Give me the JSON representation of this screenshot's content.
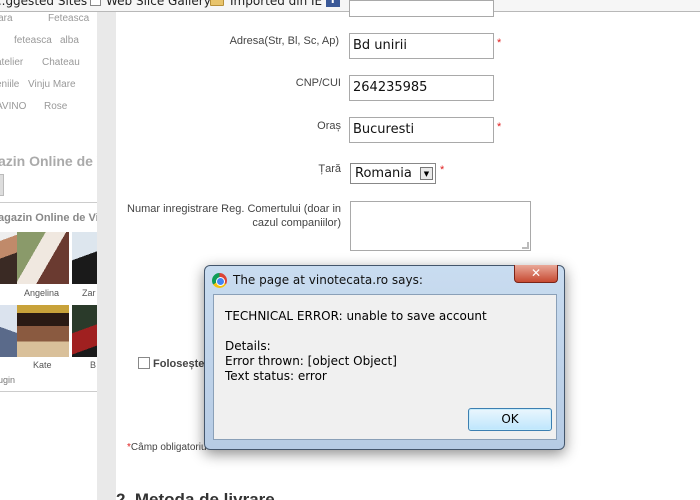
{
  "bookmarks": {
    "items": [
      "...ggested Sites",
      "Web Slice Gallery",
      "Imported din IE"
    ],
    "facebook_glyph": "f"
  },
  "left_column": {
    "tags": [
      "Fara",
      "Feteasca",
      "feteasca",
      "alba",
      "atelier",
      "Chateau",
      "eniile",
      "Vinju Mare",
      "AVINO",
      "Rose"
    ],
    "heading_1": "azin Online de Vi",
    "heading_2": "agazin Online de Vi",
    "people": [
      "Angelina",
      "Zar",
      "Kate",
      "B"
    ],
    "plugin_label": "lugin"
  },
  "form": {
    "address_label": "Adresa(Str, Bl, Sc, Ap)",
    "address_value": "Bd unirii",
    "cnp_label": "CNP/CUI",
    "cnp_value": "264235985",
    "city_label": "Oraș",
    "city_value": "Bucuresti",
    "country_label": "Țară",
    "country_value": "Romania",
    "reg_label_line1": "Numar inregistrare Reg. Comertului (doar in",
    "reg_label_line2": "cazul companiilor)",
    "reg_value": "",
    "checkbox_label": "Folosește",
    "required_marker": "*",
    "required_note": "Câmp obligatoriu",
    "next_section": "2. Metoda de livrare"
  },
  "dialog": {
    "title": "The page at vinotecata.ro says:",
    "close_glyph": "✕",
    "line_1": "TECHNICAL ERROR: unable to save account",
    "line_2": "Details:",
    "line_3": "Error thrown: [object Object]",
    "line_4": "Text status: error",
    "ok_label": "OK"
  },
  "colors": {
    "required": "#e02020",
    "dialog_frame": "#b6cbe4",
    "close_button": "#c74a32"
  }
}
